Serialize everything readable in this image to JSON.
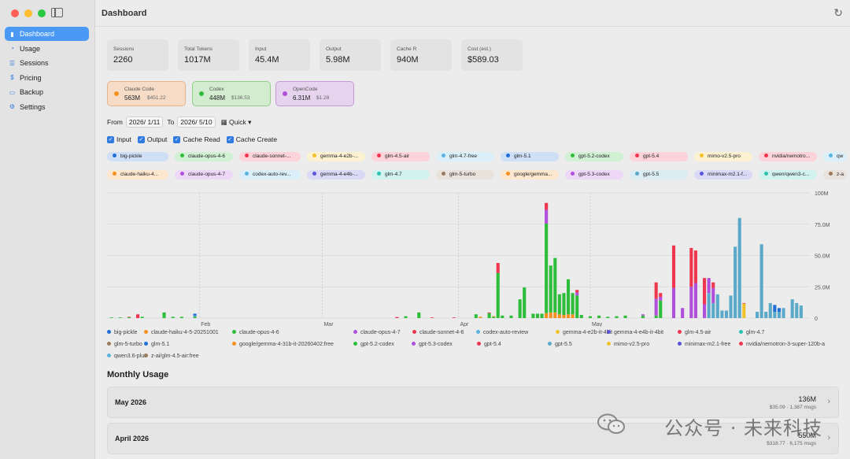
{
  "sidebar": {
    "items": [
      {
        "label": "Dashboard",
        "icon": "bar-chart-icon",
        "active": true
      },
      {
        "label": "Usage",
        "icon": "gauge-icon",
        "active": false
      },
      {
        "label": "Sessions",
        "icon": "list-icon",
        "active": false
      },
      {
        "label": "Pricing",
        "icon": "dollar-icon",
        "active": false
      },
      {
        "label": "Backup",
        "icon": "tray-icon",
        "active": false
      },
      {
        "label": "Settings",
        "icon": "gear-icon",
        "active": false
      }
    ]
  },
  "header": {
    "title": "Dashboard"
  },
  "stats": [
    {
      "label": "Sessions",
      "value": "2260"
    },
    {
      "label": "Total Tokens",
      "value": "1017M"
    },
    {
      "label": "Input",
      "value": "45.4M"
    },
    {
      "label": "Output",
      "value": "5.98M"
    },
    {
      "label": "Cache R",
      "value": "940M"
    },
    {
      "label": "Cost (est.)",
      "value": "$589.03"
    }
  ],
  "tools": [
    {
      "name": "Claude Code",
      "tokens": "563M",
      "cost": "$451.22",
      "color": "#f5901e"
    },
    {
      "name": "Codex",
      "tokens": "448M",
      "cost": "$136.53",
      "color": "#2ebd3a"
    },
    {
      "name": "OpenCode",
      "tokens": "6.31M",
      "cost": "$1.28",
      "color": "#b04fd9"
    }
  ],
  "filters": {
    "from_label": "From",
    "from_value": "2026/ 1/11",
    "to_label": "To",
    "to_value": "2026/ 5/10",
    "quick_label": "Quick"
  },
  "checks": [
    "Input",
    "Output",
    "Cache Read",
    "Cache Create"
  ],
  "model_pills": [
    {
      "label": "big-pickle",
      "color": "#1f6fd6"
    },
    {
      "label": "claude-opus-4-6",
      "color": "#2ebd3a"
    },
    {
      "label": "claude-sonnet-...",
      "color": "#f0364e"
    },
    {
      "label": "gemma-4-e2b-...",
      "color": "#f2c12e"
    },
    {
      "label": "glm-4.5-air",
      "color": "#f0364e"
    },
    {
      "label": "glm-4.7-free",
      "color": "#5ab4e0"
    },
    {
      "label": "glm-5.1",
      "color": "#1f6fd6"
    },
    {
      "label": "gpt-5.2-codex",
      "color": "#2ebd3a"
    },
    {
      "label": "gpt-5.4",
      "color": "#f0364e"
    },
    {
      "label": "mimo-v2.5-pro",
      "color": "#f2c12e"
    },
    {
      "label": "nvidia/nemotro...",
      "color": "#f0364e"
    },
    {
      "label": "qw",
      "color": "#5ab4e0"
    },
    {
      "label": "claude-haiku-4...",
      "color": "#f5901e"
    },
    {
      "label": "claude-opus-4-7",
      "color": "#b04fd9"
    },
    {
      "label": "codex-auto-rev...",
      "color": "#5ab4e0"
    },
    {
      "label": "gemma-4-e4b-...",
      "color": "#5a55d6"
    },
    {
      "label": "glm-4.7",
      "color": "#2ec2b0"
    },
    {
      "label": "glm-5-turbo",
      "color": "#9a7a5c"
    },
    {
      "label": "google/gemma...",
      "color": "#f5901e"
    },
    {
      "label": "gpt-5.3-codex",
      "color": "#b04fd9"
    },
    {
      "label": "gpt-5.5",
      "color": "#5aa9c9"
    },
    {
      "label": "minimax-m2.1-f...",
      "color": "#5a55d6"
    },
    {
      "label": "qwen/qwen3-c...",
      "color": "#2ec2b0"
    },
    {
      "label": "z-a",
      "color": "#9a7a5c"
    }
  ],
  "chart_data": {
    "type": "bar",
    "stacked": true,
    "x_ticks": [
      "Feb",
      "Mar",
      "Apr",
      "May"
    ],
    "y_ticks": [
      "0",
      "25.0M",
      "50.0M",
      "75.0M",
      "100M"
    ],
    "ylim": [
      0,
      100
    ],
    "y_unit": "M",
    "series_colors": {
      "claude-opus-4-6": "#2ebd3a",
      "claude-opus-4-7": "#b04fd9",
      "claude-sonnet-4-6": "#f0364e",
      "claude-haiku-4-5-20251001": "#f5901e",
      "gpt-5.5": "#5aa9c9",
      "glm-5.1": "#1f6fd6",
      "mimo-v2.5-pro": "#f2c12e"
    },
    "days": [
      {
        "d": 1,
        "s": [
          [
            "claude-opus-4-6",
            0.5
          ]
        ]
      },
      {
        "d": 3,
        "s": [
          [
            "claude-opus-4-6",
            0.5
          ]
        ]
      },
      {
        "d": 5,
        "s": [
          [
            "claude-opus-4-6",
            0.6
          ],
          [
            "claude-sonnet-4-6",
            0.4
          ]
        ]
      },
      {
        "d": 7,
        "s": [
          [
            "claude-sonnet-4-6",
            3.0
          ]
        ]
      },
      {
        "d": 8,
        "s": [
          [
            "claude-opus-4-6",
            1.0
          ]
        ]
      },
      {
        "d": 13,
        "s": [
          [
            "claude-opus-4-6",
            4.5
          ]
        ]
      },
      {
        "d": 15,
        "s": [
          [
            "claude-opus-4-6",
            1.0
          ]
        ]
      },
      {
        "d": 17,
        "s": [
          [
            "claude-opus-4-6",
            1.0
          ]
        ]
      },
      {
        "d": 20,
        "s": [
          [
            "claude-opus-4-6",
            1.0
          ],
          [
            "gpt-5.5",
            1.0
          ],
          [
            "glm-5.1",
            1.5
          ]
        ]
      },
      {
        "d": 66,
        "s": [
          [
            "claude-sonnet-4-6",
            0.8
          ]
        ]
      },
      {
        "d": 68,
        "s": [
          [
            "claude-opus-4-6",
            1.5
          ]
        ]
      },
      {
        "d": 71,
        "s": [
          [
            "claude-opus-4-6",
            4.5
          ]
        ]
      },
      {
        "d": 74,
        "s": [
          [
            "claude-sonnet-4-6",
            0.5
          ]
        ]
      },
      {
        "d": 79,
        "s": [
          [
            "claude-sonnet-4-6",
            0.5
          ]
        ]
      },
      {
        "d": 84,
        "s": [
          [
            "claude-opus-4-6",
            3.0
          ]
        ]
      },
      {
        "d": 85,
        "s": [
          [
            "claude-haiku-4-5-20251001",
            1.0
          ]
        ]
      },
      {
        "d": 87,
        "s": [
          [
            "claude-opus-4-6",
            4.0
          ],
          [
            "claude-sonnet-4-6",
            0.5
          ]
        ]
      },
      {
        "d": 88,
        "s": [
          [
            "claude-opus-4-6",
            1.0
          ],
          [
            "claude-haiku-4-5-20251001",
            0.5
          ]
        ]
      },
      {
        "d": 89,
        "s": [
          [
            "claude-opus-4-6",
            36.0
          ],
          [
            "claude-opus-4-7",
            0.0
          ],
          [
            "claude-sonnet-4-6",
            8.0
          ]
        ]
      },
      {
        "d": 90,
        "s": [
          [
            "claude-opus-4-6",
            2.0
          ]
        ]
      },
      {
        "d": 92,
        "s": [
          [
            "claude-opus-4-6",
            2.0
          ]
        ]
      },
      {
        "d": 94,
        "s": [
          [
            "claude-opus-4-6",
            15.0
          ]
        ]
      },
      {
        "d": 95,
        "s": [
          [
            "claude-opus-4-6",
            24.5
          ]
        ]
      },
      {
        "d": 97,
        "s": [
          [
            "claude-opus-4-6",
            3.5
          ]
        ]
      },
      {
        "d": 98,
        "s": [
          [
            "claude-opus-4-6",
            3.5
          ]
        ]
      },
      {
        "d": 99,
        "s": [
          [
            "claude-opus-4-6",
            3.5
          ]
        ]
      },
      {
        "d": 100,
        "s": [
          [
            "claude-haiku-4-5-20251001",
            4.0
          ],
          [
            "claude-opus-4-6",
            71.5
          ],
          [
            "claude-opus-4-7",
            11.0
          ],
          [
            "claude-sonnet-4-6",
            5.5
          ]
        ]
      },
      {
        "d": 101,
        "s": [
          [
            "claude-haiku-4-5-20251001",
            4.5
          ],
          [
            "claude-opus-4-6",
            37.5
          ]
        ]
      },
      {
        "d": 102,
        "s": [
          [
            "claude-haiku-4-5-20251001",
            4.5
          ],
          [
            "claude-opus-4-6",
            43.5
          ]
        ]
      },
      {
        "d": 103,
        "s": [
          [
            "claude-haiku-4-5-20251001",
            3.0
          ],
          [
            "claude-opus-4-6",
            16.0
          ]
        ]
      },
      {
        "d": 104,
        "s": [
          [
            "claude-haiku-4-5-20251001",
            2.5
          ],
          [
            "claude-opus-4-6",
            17.5
          ]
        ]
      },
      {
        "d": 105,
        "s": [
          [
            "claude-haiku-4-5-20251001",
            3.0
          ],
          [
            "claude-opus-4-6",
            28.0
          ]
        ]
      },
      {
        "d": 106,
        "s": [
          [
            "claude-haiku-4-5-20251001",
            3.0
          ],
          [
            "claude-opus-4-6",
            17.0
          ]
        ]
      },
      {
        "d": 107,
        "s": [
          [
            "claude-opus-4-6",
            18.0
          ],
          [
            "claude-opus-4-7",
            2.5
          ],
          [
            "claude-sonnet-4-6",
            2.0
          ]
        ]
      },
      {
        "d": 108,
        "s": [
          [
            "claude-opus-4-6",
            2.5
          ]
        ]
      },
      {
        "d": 110,
        "s": [
          [
            "claude-opus-4-6",
            1.5
          ]
        ]
      },
      {
        "d": 112,
        "s": [
          [
            "claude-opus-4-6",
            2.0
          ]
        ]
      },
      {
        "d": 114,
        "s": [
          [
            "claude-opus-4-6",
            1.0
          ]
        ]
      },
      {
        "d": 116,
        "s": [
          [
            "claude-opus-4-6",
            1.5
          ]
        ]
      },
      {
        "d": 118,
        "s": [
          [
            "claude-opus-4-6",
            2.0
          ]
        ]
      },
      {
        "d": 122,
        "s": [
          [
            "claude-opus-4-6",
            2.0
          ],
          [
            "claude-opus-4-7",
            1.0
          ]
        ]
      },
      {
        "d": 125,
        "s": [
          [
            "claude-opus-4-6",
            2.0
          ],
          [
            "claude-opus-4-7",
            13.5
          ],
          [
            "claude-sonnet-4-6",
            13.0
          ]
        ]
      },
      {
        "d": 126,
        "s": [
          [
            "claude-opus-4-6",
            14.0
          ],
          [
            "claude-opus-4-7",
            3.0
          ],
          [
            "claude-sonnet-4-6",
            3.0
          ]
        ]
      },
      {
        "d": 129,
        "s": [
          [
            "claude-opus-4-7",
            24.0
          ],
          [
            "claude-sonnet-4-6",
            34.0
          ]
        ]
      },
      {
        "d": 131,
        "s": [
          [
            "claude-opus-4-7",
            8.0
          ]
        ]
      },
      {
        "d": 133,
        "s": [
          [
            "claude-opus-4-7",
            25.0
          ],
          [
            "claude-sonnet-4-6",
            31.0
          ]
        ]
      },
      {
        "d": 134,
        "s": [
          [
            "claude-opus-4-7",
            28.0
          ],
          [
            "claude-sonnet-4-6",
            26.0
          ]
        ]
      },
      {
        "d": 136,
        "s": [
          [
            "claude-opus-4-7",
            11.0
          ],
          [
            "claude-sonnet-4-6",
            21.0
          ]
        ]
      },
      {
        "d": 137,
        "s": [
          [
            "gpt-5.5",
            20.0
          ],
          [
            "claude-opus-4-7",
            12.0
          ]
        ]
      },
      {
        "d": 138,
        "s": [
          [
            "gpt-5.5",
            12.0
          ],
          [
            "claude-opus-4-7",
            12.0
          ],
          [
            "claude-sonnet-4-6",
            4.5
          ]
        ]
      },
      {
        "d": 139,
        "s": [
          [
            "gpt-5.5",
            19.0
          ]
        ]
      },
      {
        "d": 140,
        "s": [
          [
            "gpt-5.5",
            6.0
          ]
        ]
      },
      {
        "d": 141,
        "s": [
          [
            "gpt-5.5",
            6.0
          ]
        ]
      },
      {
        "d": 142,
        "s": [
          [
            "gpt-5.5",
            18.0
          ]
        ]
      },
      {
        "d": 143,
        "s": [
          [
            "gpt-5.5",
            57.0
          ],
          [
            "claude-opus-4-7",
            0.0
          ]
        ]
      },
      {
        "d": 144,
        "s": [
          [
            "gpt-5.5",
            80.0
          ]
        ]
      },
      {
        "d": 145,
        "s": [
          [
            "mimo-v2.5-pro",
            11.5
          ],
          [
            "claude-sonnet-4-6",
            0.5
          ]
        ]
      },
      {
        "d": 148,
        "s": [
          [
            "gpt-5.5",
            5.0
          ]
        ]
      },
      {
        "d": 149,
        "s": [
          [
            "gpt-5.5",
            59.0
          ]
        ]
      },
      {
        "d": 150,
        "s": [
          [
            "gpt-5.5",
            5.0
          ]
        ]
      },
      {
        "d": 151,
        "s": [
          [
            "gpt-5.5",
            12.0
          ]
        ]
      },
      {
        "d": 152,
        "s": [
          [
            "gpt-5.5",
            5.0
          ],
          [
            "glm-5.1",
            5.5
          ]
        ]
      },
      {
        "d": 153,
        "s": [
          [
            "gpt-5.5",
            5.0
          ],
          [
            "glm-5.1",
            3.0
          ]
        ]
      },
      {
        "d": 154,
        "s": [
          [
            "gpt-5.5",
            8.0
          ]
        ]
      },
      {
        "d": 156,
        "s": [
          [
            "gpt-5.5",
            15.0
          ]
        ]
      },
      {
        "d": 157,
        "s": [
          [
            "gpt-5.5",
            12.0
          ]
        ]
      },
      {
        "d": 158,
        "s": [
          [
            "gpt-5.5",
            10.0
          ]
        ]
      }
    ]
  },
  "chart_legend": [
    {
      "label": "big-pickle",
      "color": "#1f6fd6"
    },
    {
      "label": "claude-haiku-4-5-20251001",
      "color": "#f5901e"
    },
    {
      "label": "claude-opus-4-6",
      "color": "#2ebd3a"
    },
    {
      "label": "claude-opus-4-7",
      "color": "#b04fd9"
    },
    {
      "label": "claude-sonnet-4-6",
      "color": "#f0364e"
    },
    {
      "label": "codex-auto-review",
      "color": "#5ab4e0"
    },
    {
      "label": "gemma-4-e2b-it-4bit",
      "color": "#f2c12e"
    },
    {
      "label": "gemma-4-e4b-it-4bit",
      "color": "#5a55d6"
    },
    {
      "label": "glm-4.5-air",
      "color": "#f0364e"
    },
    {
      "label": "glm-4.7",
      "color": "#2ec2b0"
    },
    {
      "label": "glm-5-turbo",
      "color": "#9a7a5c"
    },
    {
      "label": "glm-5.1",
      "color": "#1f6fd6"
    },
    {
      "label": "google/gemma-4-31b-it-20260402:free",
      "color": "#f5901e"
    },
    {
      "label": "gpt-5.2-codex",
      "color": "#2ebd3a"
    },
    {
      "label": "gpt-5.3-codex",
      "color": "#b04fd9"
    },
    {
      "label": "gpt-5.4",
      "color": "#f0364e"
    },
    {
      "label": "gpt-5.5",
      "color": "#5aa9c9"
    },
    {
      "label": "mimo-v2.5-pro",
      "color": "#f2c12e"
    },
    {
      "label": "minimax-m2.1-free",
      "color": "#5a55d6"
    },
    {
      "label": "nvidia/nemotron-3-super-120b-a",
      "color": "#f0364e"
    },
    {
      "label": "qwen3.6-plus",
      "color": "#5ab4e0"
    },
    {
      "label": "z-ai/glm-4.5-air:free",
      "color": "#9a7a5c"
    }
  ],
  "monthly": {
    "title": "Monthly Usage",
    "rows": [
      {
        "month": "May 2026",
        "tokens": "136M",
        "detail": "$35.09 · 1,387 msgs"
      },
      {
        "month": "April 2026",
        "tokens": "550M",
        "detail": "$318.77 · 6,175 msgs"
      }
    ]
  },
  "watermark": "公众号 · 未来科技"
}
